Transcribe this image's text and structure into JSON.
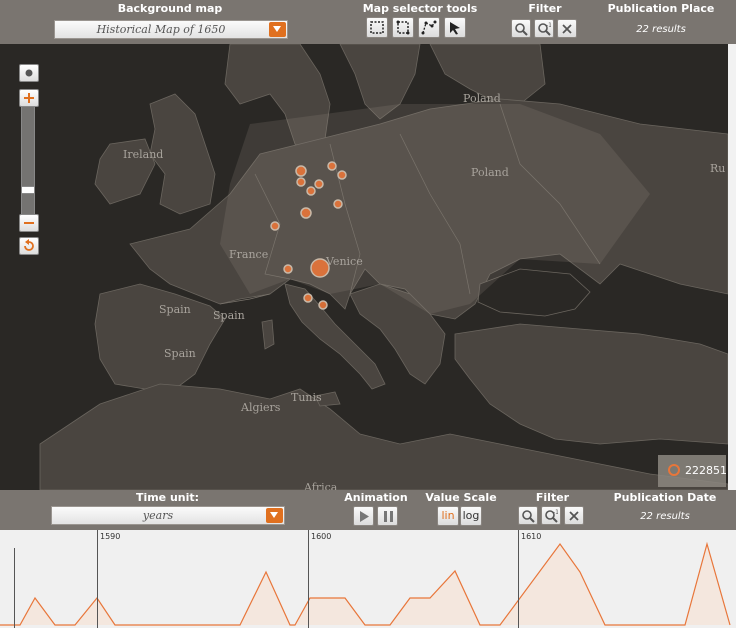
{
  "top_bar": {
    "background_map_title": "Background map",
    "background_map_value": "Historical Map of 1650",
    "selector_title": "Map selector tools",
    "selector_tools": [
      "rectangle-select",
      "polygon-select",
      "lasso-select",
      "pointer-select"
    ],
    "filter_title": "Filter",
    "filter_buttons": [
      "zoom-in-filter",
      "zoom-out-filter",
      "clear-filter"
    ],
    "place_title": "Publication Place",
    "place_results": "22 results"
  },
  "map": {
    "labels": {
      "ireland": "Ireland",
      "poland_1": "Poland",
      "poland_2": "Poland",
      "france": "France",
      "venice": "Venice",
      "spain_1": "Spain",
      "spain_2": "Spain",
      "spain_3": "Spain",
      "algiers": "Algiers",
      "tunis": "Tunis",
      "africa": "Africa",
      "ru": "Ru"
    },
    "legend_value": "222851",
    "accent_color": "#e8763a"
  },
  "bottom_bar": {
    "time_unit_title": "Time unit:",
    "time_unit_value": "years",
    "animation_title": "Animation",
    "value_scale_title": "Value Scale",
    "scale_lin": "lin",
    "scale_log": "log",
    "scale_selected": "lin",
    "filter_title": "Filter",
    "date_title": "Publication Date",
    "date_results": "22 results"
  },
  "timeline": {
    "tick_labels": [
      "1590",
      "1600",
      "1610"
    ]
  }
}
